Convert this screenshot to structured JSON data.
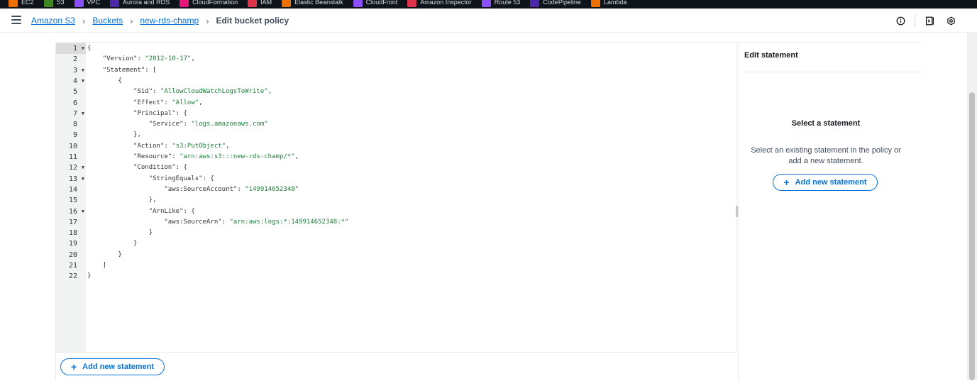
{
  "favorites": [
    {
      "label": "EC2",
      "color": "#ed7100"
    },
    {
      "label": "S3",
      "color": "#3f8624"
    },
    {
      "label": "VPC",
      "color": "#8c4fff"
    },
    {
      "label": "Aurora and RDS",
      "color": "#4d27aa"
    },
    {
      "label": "CloudFormation",
      "color": "#e7157b"
    },
    {
      "label": "IAM",
      "color": "#dd344c"
    },
    {
      "label": "Elastic Beanstalk",
      "color": "#ed7100"
    },
    {
      "label": "CloudFront",
      "color": "#8c4fff"
    },
    {
      "label": "Amazon Inspector",
      "color": "#dd344c"
    },
    {
      "label": "Route 53",
      "color": "#8c4fff"
    },
    {
      "label": "CodePipeline",
      "color": "#4d27aa"
    },
    {
      "label": "Lambda",
      "color": "#ed7100"
    }
  ],
  "breadcrumb": {
    "items": [
      "Amazon S3",
      "Buckets",
      "new-rds-champ"
    ],
    "current": "Edit bucket policy"
  },
  "header_icons": [
    "info-icon",
    "notifications-panel-icon",
    "settings-icon"
  ],
  "editor": {
    "line_numbers": [
      "1",
      "2",
      "3",
      "4",
      "5",
      "6",
      "7",
      "8",
      "9",
      "10",
      "11",
      "12",
      "13",
      "14",
      "15",
      "16",
      "17",
      "18",
      "19",
      "20",
      "21",
      "22"
    ],
    "foldable_lines": [
      1,
      3,
      4,
      7,
      12,
      13,
      16
    ],
    "lines": [
      "{",
      "    \"Version\": \"2012-10-17\",",
      "    \"Statement\": [",
      "        {",
      "            \"Sid\": \"AllowCloudWatchLogsToWrite\",",
      "            \"Effect\": \"Allow\",",
      "            \"Principal\": {",
      "                \"Service\": \"logs.amazonaws.com\"",
      "            },",
      "            \"Action\": \"s3:PutObject\",",
      "            \"Resource\": \"arn:aws:s3:::new-rds-champ/*\",",
      "            \"Condition\": {",
      "                \"StringEquals\": {",
      "                    \"aws:SourceAccount\": \"149914652348\"",
      "                },",
      "                \"ArnLike\": {",
      "                    \"aws:SourceArn\": \"arn:aws:logs:*:149914652348:*\"",
      "                }",
      "            }",
      "        }",
      "    ]",
      "}"
    ],
    "add_statement_label": "Add new statement"
  },
  "side_panel": {
    "title": "Edit statement",
    "empty_title": "Select a statement",
    "empty_description": "Select an existing statement in the policy or add a new statement.",
    "add_statement_label": "Add new statement"
  },
  "colors": {
    "link": "#0972d3",
    "string": "#1a7f37",
    "gutter": "#f2f3f3"
  }
}
